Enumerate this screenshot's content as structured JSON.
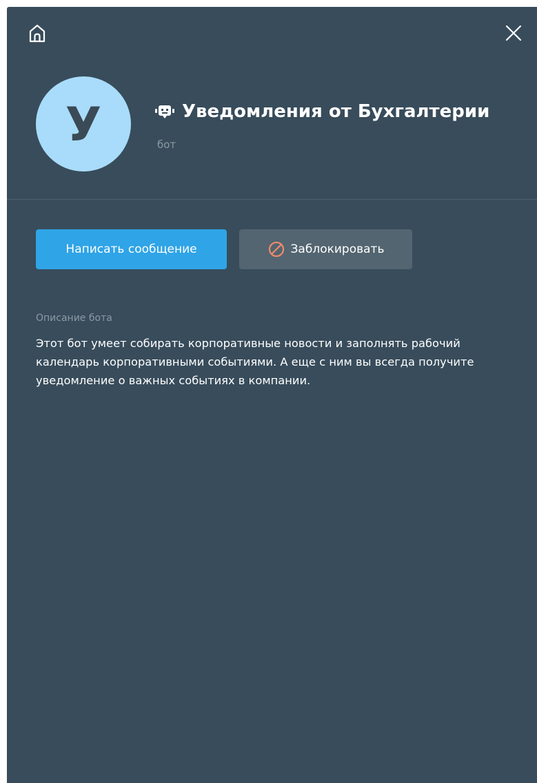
{
  "header": {
    "home_icon": "home-icon",
    "close_icon": "close-icon"
  },
  "profile": {
    "avatar_letter": "У",
    "avatar_color": "#a8dcfa",
    "type_icon": "bot-icon",
    "name": "Уведомления от Бухгалтерии",
    "subtitle": "бот"
  },
  "actions": {
    "write_label": "Написать сообщение",
    "block_label": "Заблокировать",
    "block_icon": "block-icon",
    "primary_color": "#2fa4e7"
  },
  "description": {
    "label": "Описание бота",
    "text": "Этот бот умеет собирать корпоративные новости и заполнять рабочий календарь корпоративными событиями. А еще с ним вы всегда получите уведомление о важных событиях в компании."
  },
  "colors": {
    "panel_bg": "#384c5b",
    "block_icon_accent": "#f08a6c"
  }
}
